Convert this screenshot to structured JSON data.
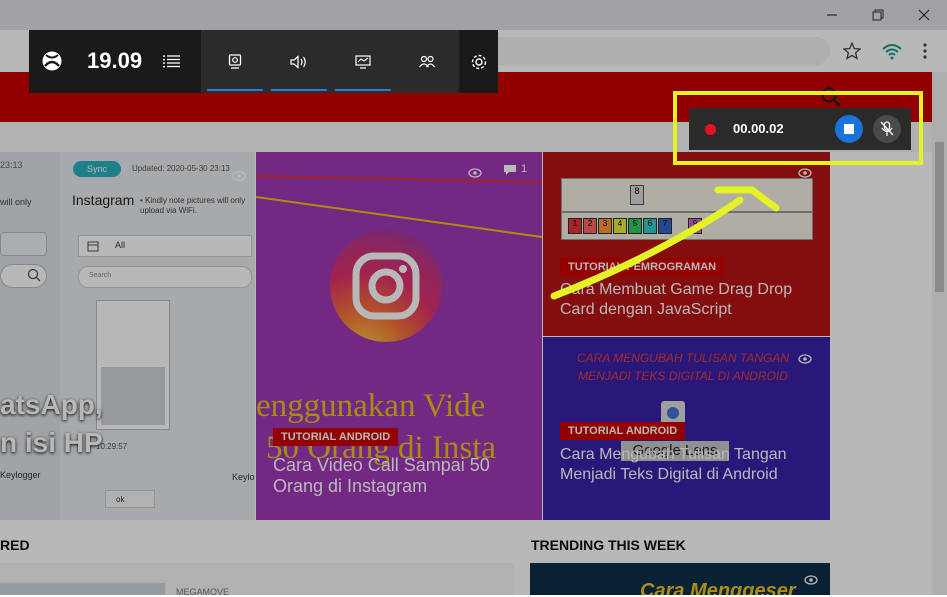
{
  "gamebar": {
    "clock": "19.09",
    "tabs": [
      "capture-widget",
      "audio-widget",
      "performance-widget",
      "social-widget"
    ]
  },
  "recording": {
    "timer": "00.00.02"
  },
  "cards": {
    "left": {
      "sync_badge": "Sync",
      "updated": "Updated: 2020-05-30 23:13",
      "time_left": "23:13",
      "app_title": "Instagram",
      "app_note": "• Kindly note pictures will only upload via WiFi.",
      "left_note": "will only",
      "filter_all": "All",
      "search_label": "Search",
      "headline_1": "atsApp,",
      "headline_2": "n isi HP",
      "keylogger_1": "Keylogger",
      "keylogger_2": "Keylo",
      "ok_label": "ok",
      "timestamp": "10:29:57"
    },
    "insta": {
      "comment_count": "1",
      "overlay_line_1": "enggunakan Vide",
      "overlay_line_2": "50 Orang di Insta",
      "tag": "TUTORIAL ANDROID",
      "title": "Cara Video Call Sampai 50 Orang di Instagram"
    },
    "game": {
      "tag": "TUTORIAL PEMROGRAMAN",
      "title": "Cara Membuat Game Drag Drop Card dengan JavaScript",
      "tiles": [
        "1",
        "2",
        "3",
        "4",
        "5",
        "6",
        "7",
        "8",
        "9"
      ],
      "top_tile": "8"
    },
    "ocr": {
      "overlay": "CARA MENGUBAH TULISAN TANGAN MENJADI TEKS DIGITAL DI ANDROID",
      "tag": "TUTORIAL ANDROID",
      "lens": "Google Lens",
      "title": "Cara Mengubah Tulisan Tangan Menjadi Teks Digital di Android"
    }
  },
  "sections": {
    "left_heading": "RED",
    "trending_heading": "TRENDING THIS WEEK",
    "author": "MEGAMOVE",
    "trending_overlay": "Cara Menggeser"
  },
  "colors": {
    "brand": "#cc0000",
    "highlight": "#e4f226",
    "accent": "#2b7fd6"
  }
}
